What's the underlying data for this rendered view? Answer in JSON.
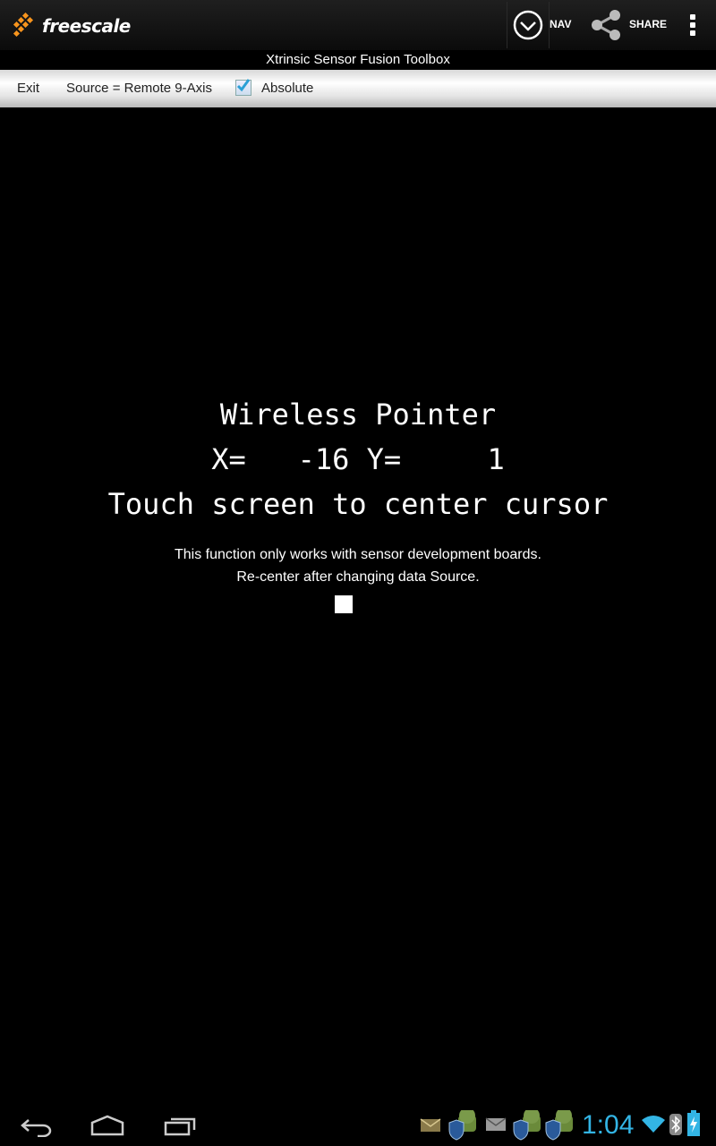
{
  "app": {
    "brand": "freescale",
    "title": "Xtrinsic Sensor Fusion Toolbox",
    "nav_label": "NAV",
    "share_label": "SHARE"
  },
  "toolbar": {
    "exit_label": "Exit",
    "source_label": "Source = Remote 9-Axis",
    "absolute_label": "Absolute",
    "absolute_checked": true
  },
  "pointer": {
    "heading": "Wireless Pointer",
    "coords_text": "X=   -16 Y=     1",
    "x_label": "X=",
    "x_value": "-16",
    "y_label": "Y=",
    "y_value": "1",
    "instruction": "Touch screen to center cursor",
    "note_line1": "This function only works with sensor development boards.",
    "note_line2": "Re-center after changing data Source."
  },
  "system": {
    "time": "1:04",
    "accent": "#33b5e5"
  }
}
